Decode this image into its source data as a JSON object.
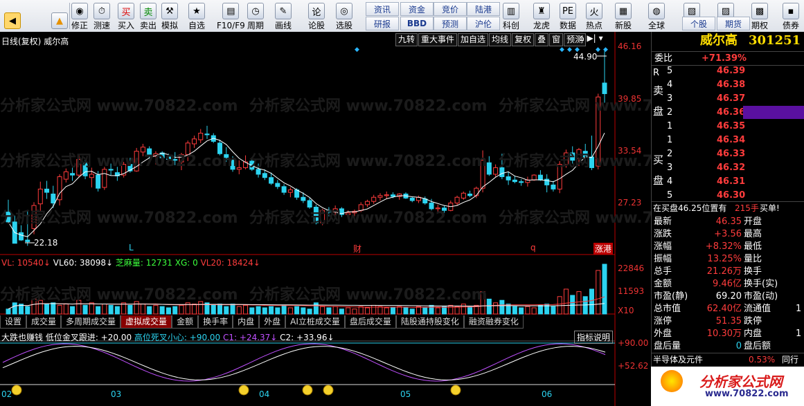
{
  "toolbar": {
    "buttons": [
      "修正",
      "测速",
      "买入",
      "卖出",
      "模拟",
      "自选",
      "F10/F9",
      "周期",
      "画线",
      "论股",
      "选股",
      "科创",
      "龙虎",
      "数据",
      "热点",
      "新股",
      "全球",
      "板块",
      "股指",
      "期权",
      "债券"
    ],
    "text_buttons": [
      "资讯",
      "资金",
      "竞价",
      "陆港",
      "研报",
      "BBD",
      "预测",
      "沪伦",
      "个股",
      "期货"
    ]
  },
  "chart": {
    "title": "日线(复权)",
    "stock_name": "威尔高",
    "top_buttons": [
      "九转",
      "重大事件",
      "加自选",
      "均线",
      "复权",
      "叠",
      "窗",
      "预测"
    ],
    "price_axis": [
      "46.16",
      "39.85",
      "33.54",
      "27.23"
    ],
    "high_label": "44.90",
    "low_label": "22.18",
    "markers": [
      {
        "t": "L",
        "c": "#2cd3f0"
      },
      {
        "t": "财",
        "c": "#ff3c3c"
      },
      {
        "t": "q",
        "c": "#ff3c3c"
      },
      {
        "t": "涨港",
        "c": "#ff3c3c"
      }
    ],
    "watermark": "分析家公式网 www.70822.com",
    "vol_axis": [
      "22846",
      "11593",
      "X10"
    ],
    "vol_legend": [
      {
        "t": "VL: 10540↓",
        "c": "#ff3c3c"
      },
      {
        "t": "VL60: 38098↓",
        "c": "#ffffff"
      },
      {
        "t": "芝麻量: 12731",
        "c": "#3cff3c"
      },
      {
        "t": "XG: 0",
        "c": "#3cff3c"
      },
      {
        "t": "VL20: 18424↓",
        "c": "#ff3c3c"
      }
    ],
    "indicator_tabs": [
      "设置",
      "成交量",
      "多周期成交量",
      "虚拟成交量",
      "金额",
      "换手率",
      "内盘",
      "外盘",
      "AI立桩成交量",
      "盘后成交量",
      "陆股通持股变化",
      "融资融券变化"
    ],
    "active_tab": "虚拟成交量",
    "ind_legend": [
      {
        "t": "大跌也赚钱",
        "c": "#ffffff"
      },
      {
        "t": "低位金叉跟进: +20.00",
        "c": "#ffffff"
      },
      {
        "t": "高位死叉小心: +90.00",
        "c": "#2cd3f0"
      },
      {
        "t": "C1: +24.37↓",
        "c": "#c050ff"
      },
      {
        "t": "C2: +33.96↓",
        "c": "#ffffff"
      }
    ],
    "ind_button": "指标说明",
    "ind_axis": [
      "+90.00",
      "+52.62"
    ],
    "x_axis": [
      "02",
      "03",
      "04",
      "05",
      "06"
    ]
  },
  "panel": {
    "name": "威尔高",
    "code": "301251",
    "weibi_label": "委比",
    "weibi": "+71.39%",
    "r_label": "R",
    "sell_label": "卖盘",
    "buy_label": "买盘",
    "asks": [
      {
        "n": "5",
        "p": "46.39"
      },
      {
        "n": "4",
        "p": "46.38"
      },
      {
        "n": "3",
        "p": "46.37"
      },
      {
        "n": "2",
        "p": "46.36"
      },
      {
        "n": "1",
        "p": "46.35"
      }
    ],
    "bids": [
      {
        "n": "1",
        "p": "46.34"
      },
      {
        "n": "2",
        "p": "46.33"
      },
      {
        "n": "3",
        "p": "46.32"
      },
      {
        "n": "4",
        "p": "46.31"
      },
      {
        "n": "5",
        "p": "46.30"
      }
    ],
    "buy_note": "在买盘46.25位置有",
    "buy_note_vol": "215手",
    "buy_note_tag": "买单!",
    "stats": [
      [
        "最新",
        "46.35",
        "开盘",
        ""
      ],
      [
        "涨跌",
        "+3.56",
        "最高",
        ""
      ],
      [
        "涨幅",
        "+8.32%",
        "最低",
        ""
      ],
      [
        "振幅",
        "13.25%",
        "量比",
        ""
      ],
      [
        "总手",
        "21.26万",
        "换手",
        ""
      ],
      [
        "金额",
        "9.46亿",
        "换手(实)",
        ""
      ],
      [
        "市盈(静)",
        "69.20",
        "市盈(动)",
        ""
      ],
      [
        "总市值",
        "62.40亿",
        "流通值",
        "1"
      ],
      [
        "涨停",
        "51.35",
        "跌停",
        ""
      ],
      [
        "外盘",
        "10.30万",
        "内盘",
        "1"
      ],
      [
        "盘后量",
        "0",
        "盘后额",
        ""
      ]
    ],
    "sector": "半导体及元件",
    "sector_pct": "0.53%",
    "sector_btn": "同行",
    "logo_text": "分析家公式网",
    "logo_url": "www.70822.com"
  },
  "chart_data": {
    "type": "candlestick",
    "price_axis_ticks": [
      46.16,
      39.85,
      33.54,
      27.23
    ],
    "high": 44.9,
    "low": 22.18,
    "candles": [
      [
        26.0,
        27.5,
        25.4,
        24.8
      ],
      [
        24.8,
        25.6,
        22.9,
        22.2
      ],
      [
        23.5,
        24.4,
        22.5,
        22.6
      ],
      [
        22.6,
        26.2,
        21.9,
        22.4
      ],
      [
        24.0,
        27.2,
        23.3,
        26.8
      ],
      [
        27.0,
        29.7,
        26.1,
        28.8
      ],
      [
        28.8,
        29.8,
        27.6,
        28.4
      ],
      [
        28.2,
        29.2,
        26.5,
        27.1
      ],
      [
        27.5,
        30.6,
        26.8,
        30.3
      ],
      [
        30.0,
        31.3,
        29.6,
        30.9
      ],
      [
        30.7,
        31.4,
        29.8,
        30.5
      ],
      [
        30.5,
        32.9,
        30.2,
        32.4
      ],
      [
        32.0,
        32.4,
        30.0,
        30.4
      ],
      [
        30.2,
        31.4,
        29.0,
        30.6
      ],
      [
        30.5,
        31.0,
        28.5,
        28.9
      ],
      [
        29.0,
        31.5,
        28.7,
        31.2
      ],
      [
        31.2,
        31.9,
        30.5,
        31.1
      ],
      [
        30.8,
        31.5,
        29.8,
        30.4
      ],
      [
        30.5,
        32.1,
        30.2,
        31.8
      ],
      [
        31.8,
        32.6,
        30.8,
        31.0
      ],
      [
        31.0,
        33.8,
        30.9,
        33.4
      ],
      [
        33.3,
        34.3,
        32.8,
        33.9
      ],
      [
        33.7,
        34.0,
        32.5,
        32.9
      ],
      [
        32.8,
        33.4,
        31.8,
        33.1
      ],
      [
        33.2,
        33.4,
        32.2,
        32.6
      ],
      [
        32.7,
        33.1,
        32.2,
        32.4
      ],
      [
        32.4,
        33.3,
        31.7,
        32.3
      ],
      [
        32.1,
        33.2,
        31.1,
        33.0
      ],
      [
        33.0,
        34.7,
        32.2,
        34.4
      ],
      [
        34.3,
        35.3,
        33.8,
        34.9
      ],
      [
        34.8,
        36.1,
        34.4,
        35.6
      ],
      [
        35.5,
        36.5,
        34.9,
        35.4
      ],
      [
        35.3,
        35.6,
        34.4,
        34.6
      ],
      [
        34.4,
        34.8,
        32.9,
        33.1
      ],
      [
        33.0,
        33.9,
        32.1,
        32.4
      ],
      [
        32.4,
        32.8,
        30.9,
        31.2
      ],
      [
        31.2,
        32.3,
        30.6,
        31.4
      ],
      [
        31.4,
        32.9,
        31.2,
        32.1
      ],
      [
        32.2,
        32.5,
        31.0,
        31.2
      ],
      [
        31.2,
        31.9,
        30.2,
        30.6
      ],
      [
        30.7,
        31.2,
        29.9,
        30.2
      ],
      [
        30.2,
        30.8,
        29.3,
        29.5
      ],
      [
        29.5,
        29.9,
        28.8,
        29.1
      ],
      [
        29.1,
        29.4,
        28.1,
        28.4
      ],
      [
        28.4,
        29.0,
        27.8,
        28.7
      ],
      [
        28.7,
        28.9,
        27.5,
        27.8
      ],
      [
        27.8,
        28.4,
        27.1,
        27.4
      ],
      [
        27.4,
        27.7,
        26.4,
        26.6
      ],
      [
        26.6,
        26.9,
        24.5,
        24.7
      ],
      [
        24.7,
        26.4,
        24.4,
        26.2
      ],
      [
        26.2,
        26.6,
        25.5,
        26.0
      ],
      [
        26.0,
        26.8,
        25.6,
        26.4
      ],
      [
        26.4,
        26.6,
        25.4,
        25.7
      ],
      [
        25.7,
        26.2,
        25.4,
        25.9
      ],
      [
        25.9,
        26.3,
        25.5,
        26.1
      ],
      [
        26.2,
        27.2,
        26.0,
        26.9
      ],
      [
        26.9,
        27.5,
        26.6,
        27.3
      ],
      [
        27.3,
        28.1,
        27.0,
        27.8
      ],
      [
        27.8,
        28.3,
        27.4,
        28.0
      ],
      [
        28.0,
        28.5,
        27.6,
        28.1
      ],
      [
        28.1,
        28.4,
        27.7,
        27.9
      ],
      [
        27.9,
        28.3,
        27.5,
        28.2
      ],
      [
        28.2,
        28.4,
        27.6,
        27.7
      ],
      [
        27.7,
        27.9,
        27.2,
        27.4
      ],
      [
        27.4,
        28.0,
        27.1,
        27.8
      ],
      [
        27.6,
        27.9,
        26.9,
        27.1
      ],
      [
        27.1,
        27.6,
        26.2,
        26.4
      ],
      [
        26.4,
        26.9,
        26.0,
        26.5
      ],
      [
        26.5,
        26.8,
        25.9,
        26.2
      ],
      [
        26.2,
        27.4,
        26.1,
        27.1
      ],
      [
        27.1,
        28.0,
        26.8,
        27.8
      ],
      [
        27.7,
        28.5,
        27.5,
        28.3
      ],
      [
        28.2,
        28.6,
        27.8,
        28.0
      ],
      [
        28.0,
        29.1,
        27.7,
        28.9
      ],
      [
        28.9,
        33.5,
        28.4,
        32.3
      ],
      [
        32.0,
        32.8,
        30.4,
        30.6
      ],
      [
        30.6,
        31.8,
        30.3,
        31.4
      ],
      [
        31.4,
        33.1,
        30.0,
        30.3
      ],
      [
        30.3,
        30.9,
        29.3,
        29.9
      ],
      [
        29.9,
        30.4,
        29.5,
        29.7
      ],
      [
        29.7,
        30.0,
        29.2,
        29.6
      ],
      [
        29.6,
        30.3,
        29.1,
        29.9
      ],
      [
        29.9,
        30.6,
        29.8,
        30.5
      ],
      [
        30.5,
        31.1,
        29.8,
        29.9
      ],
      [
        30.0,
        30.6,
        28.4,
        29.3
      ],
      [
        29.3,
        29.8,
        28.5,
        28.8
      ],
      [
        28.8,
        32.2,
        28.3,
        31.8
      ],
      [
        31.8,
        33.6,
        31.4,
        33.2
      ],
      [
        33.2,
        34.0,
        31.9,
        32.3
      ],
      [
        32.5,
        33.8,
        31.6,
        33.6
      ],
      [
        33.4,
        34.3,
        32.0,
        32.7
      ],
      [
        32.7,
        35.3,
        31.1,
        31.4
      ],
      [
        31.6,
        40.4,
        31.2,
        40.0
      ],
      [
        41.7,
        45.6,
        39.3,
        40.4
      ]
    ],
    "volume_axis_ticks": [
      22846,
      11593
    ],
    "volume": [
      4,
      9,
      8,
      6,
      12,
      11,
      8,
      9,
      7,
      8,
      6,
      11,
      7,
      9,
      6,
      8,
      7,
      6,
      9,
      7,
      10,
      8,
      6,
      7,
      6,
      5,
      6,
      7,
      9,
      8,
      10,
      9,
      7,
      8,
      6,
      8,
      6,
      7,
      5,
      6,
      5,
      6,
      5,
      7,
      5,
      6,
      5,
      4,
      9,
      6,
      5,
      6,
      4,
      5,
      4,
      6,
      5,
      7,
      6,
      5,
      5,
      6,
      5,
      4,
      6,
      5,
      7,
      5,
      6,
      7,
      6,
      8,
      6,
      7,
      18,
      12,
      9,
      11,
      8,
      6,
      5,
      6,
      5,
      7,
      8,
      6,
      14,
      20,
      15,
      18,
      14,
      20,
      35,
      40
    ]
  }
}
